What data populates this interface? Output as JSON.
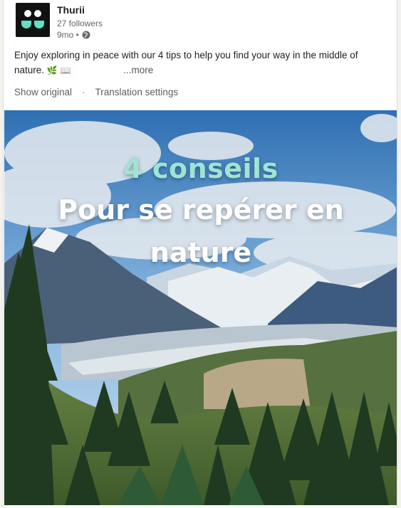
{
  "post": {
    "author": "Thurii",
    "followers": "27 followers",
    "time": "9mo •",
    "globe_icon": "globe-icon",
    "text": "Enjoy exploring in peace with our 4 tips to help you find your way in the middle of nature.",
    "emoji_1": "🌿",
    "emoji_2": "📖",
    "more": "...more",
    "show_original": "Show original",
    "dot": "·",
    "translation_settings": "Translation settings"
  },
  "image": {
    "title": "4 conseils",
    "subtitle_line1": "Pour se repérer en",
    "subtitle_line2": "nature"
  },
  "colors": {
    "logo_bg": "#111111",
    "logo_accent": "#5fe0c7",
    "title_accent": "#9fe4d4"
  }
}
